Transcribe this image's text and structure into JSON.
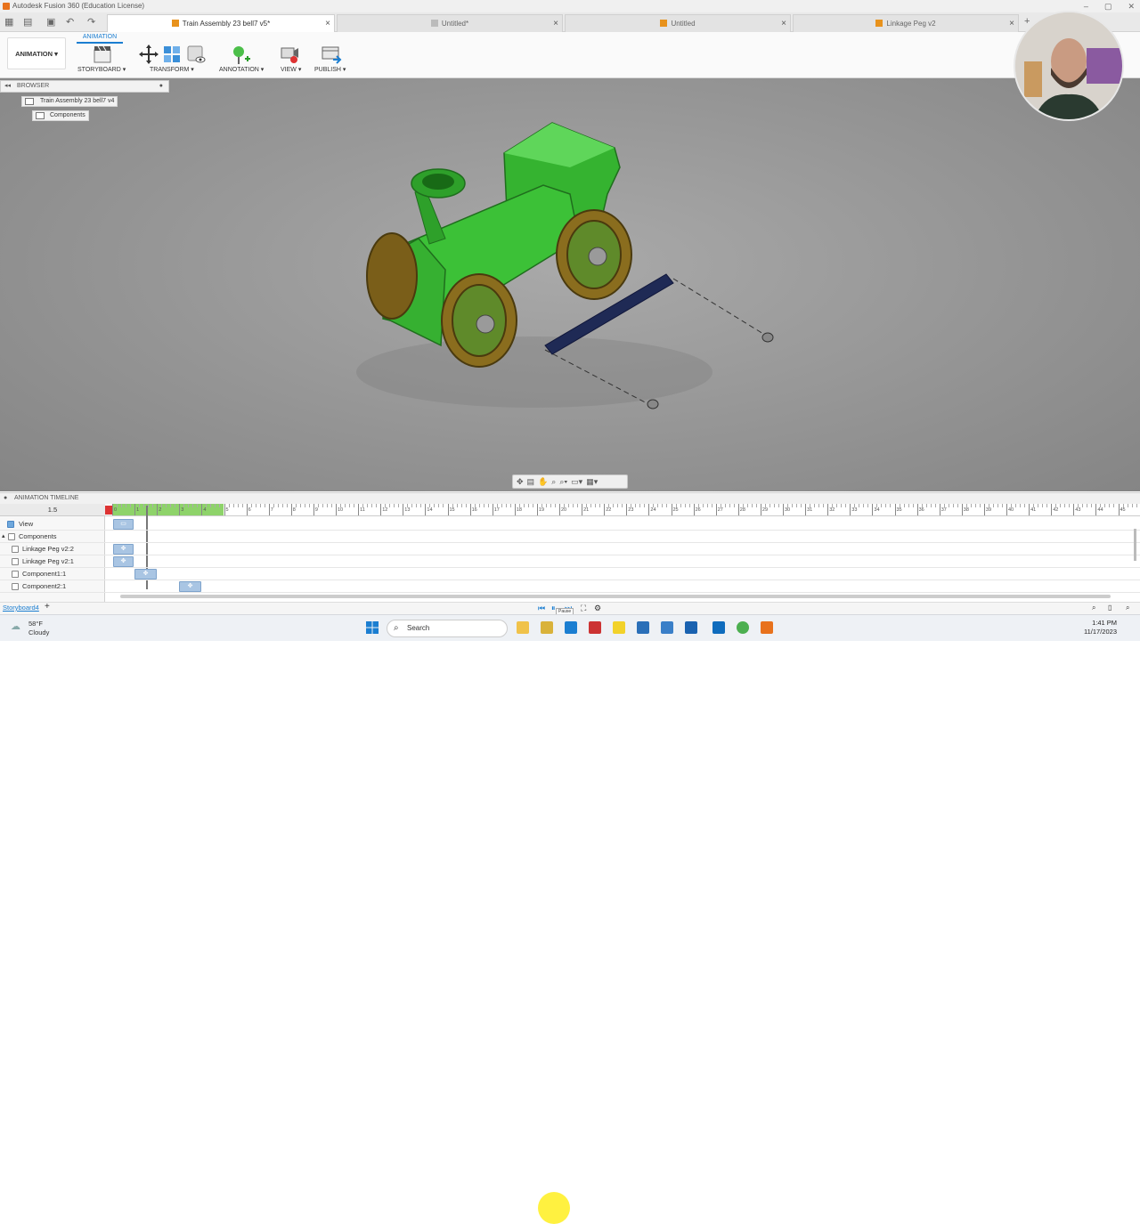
{
  "titlebar": {
    "title": "Autodesk Fusion 360 (Education License)"
  },
  "tabs": [
    {
      "label": "Train Assembly 23 bell7 v5*",
      "active": true
    },
    {
      "label": "Untitled*",
      "active": false
    },
    {
      "label": "Untitled",
      "active": false
    },
    {
      "label": "Linkage Peg v2",
      "active": false
    }
  ],
  "toolbar": {
    "workspace": "ANIMATION",
    "ribbon_tab": "ANIMATION",
    "groups": [
      "STORYBOARD",
      "TRANSFORM",
      "ANNOTATION",
      "VIEW",
      "PUBLISH"
    ]
  },
  "browser": {
    "title": "BROWSER",
    "root": "Train Assembly 23 bell7 v4",
    "child": "Components"
  },
  "timeline": {
    "title": "ANIMATION TIMELINE",
    "current_time": "1.5",
    "rows": [
      "View",
      "Components",
      "Linkage Peg v2:2",
      "Linkage Peg v2:1",
      "Component1:1",
      "Component2:1"
    ],
    "ticks": [
      "0",
      "1",
      "2",
      "3",
      "4",
      "5",
      "6",
      "7",
      "8",
      "9",
      "10",
      "11",
      "12",
      "13",
      "14",
      "15",
      "16",
      "17",
      "18",
      "19",
      "20",
      "21",
      "22",
      "23",
      "24",
      "25",
      "26",
      "27",
      "28",
      "29",
      "30",
      "31",
      "32",
      "33",
      "34",
      "35",
      "36",
      "37",
      "38",
      "39",
      "40",
      "41",
      "42",
      "43",
      "44",
      "45"
    ],
    "storyboard": "Storyboard4",
    "tooltip": "Pause"
  },
  "taskbar": {
    "weather_temp": "58°F",
    "weather_desc": "Cloudy",
    "search_placeholder": "Search",
    "time": "1:41 PM",
    "date": "11/17/2023"
  },
  "colors": {
    "body_green": "#3fc23a",
    "wheel_gold": "#8a6d1e",
    "rod_navy": "#1f2a55",
    "accent_blue": "#1b7ed1",
    "playhead_red": "#d33"
  }
}
